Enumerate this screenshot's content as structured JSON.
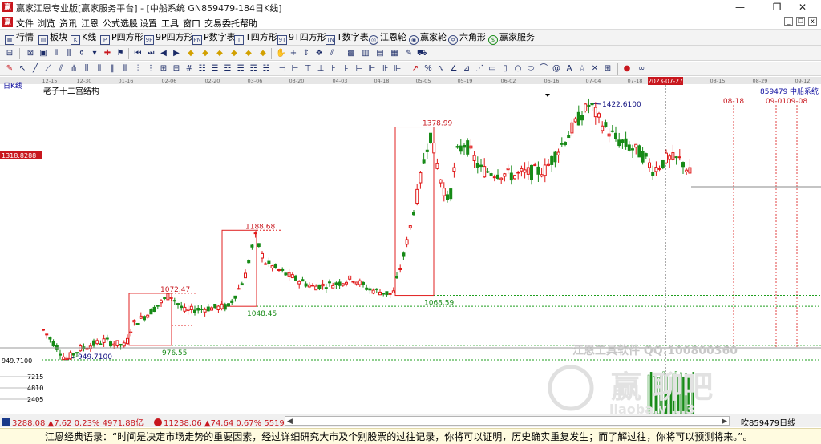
{
  "window": {
    "title": "赢家江恩专业版[赢家服务平台] - [中船系统  GN859479-184日K线]",
    "logo_text": "赢"
  },
  "menu": [
    "文件",
    "浏览",
    "资讯",
    "江恩",
    "公式选股",
    "设置",
    "工具",
    "窗口",
    "交易委托",
    "帮助"
  ],
  "toolbar1": [
    {
      "label": "行情",
      "icon": "grid-icon"
    },
    {
      "label": "板块",
      "icon": "blocks-icon"
    },
    {
      "label": "K线",
      "icon": "kline-icon"
    },
    {
      "label": "P四方形",
      "icon": "p-square-icon"
    },
    {
      "label": "9P四方形",
      "icon": "9p-square-icon"
    },
    {
      "label": "P数字表",
      "icon": "p-number-icon"
    },
    {
      "label": "T四方形",
      "icon": "t-square-icon"
    },
    {
      "label": "9T四方形",
      "icon": "9t-square-icon"
    },
    {
      "label": "T数字表",
      "icon": "t-number-icon"
    },
    {
      "label": "江恩轮",
      "icon": "gann-wheel-icon"
    },
    {
      "label": "赢家轮",
      "icon": "winner-wheel-icon"
    },
    {
      "label": "六角形",
      "icon": "hexagon-icon"
    },
    {
      "label": "赢家服务",
      "icon": "service-icon"
    }
  ],
  "chart": {
    "period_label": "日K线",
    "structure_name": "老子十二宫结构",
    "current_price": "1318.8288",
    "axis_low_label": "949.7100",
    "security_code": "859479",
    "security_name": "中船系统",
    "highlight_date": "2023-07-27",
    "date_ticks": [
      "12-15",
      "12-30",
      "01-16",
      "02-06",
      "02-20",
      "03-06",
      "03-20",
      "04-03",
      "04-18",
      "05-05",
      "05-19",
      "06-02",
      "06-16",
      "07-04",
      "07-18",
      "08-15",
      "08-29",
      "09-12"
    ],
    "future_dates": [
      "08-18",
      "09-01",
      "09-08"
    ],
    "price_labels": [
      "949.7100",
      "1072.47",
      "976.55",
      "1188.68",
      "1048.45",
      "1378.99",
      "1068.59",
      "1422.6100"
    ],
    "volume_ticks": [
      "7215",
      "4810",
      "2405"
    ],
    "watermark_tool": "江恩工具软件 QQ:100800360",
    "watermark_brand": "赢 聊吧",
    "watermark_url": "jiaoba.yi...3"
  },
  "chart_data": {
    "type": "candlestick",
    "title": "老子十二宫结构",
    "series_code": "859479",
    "series_name": "中船系统",
    "period": "日K线",
    "date_ticks": [
      "12-15",
      "12-30",
      "01-16",
      "02-06",
      "02-20",
      "03-06",
      "03-20",
      "04-03",
      "04-18",
      "05-05",
      "05-19",
      "06-02",
      "06-16",
      "07-04",
      "07-18"
    ],
    "marked_points": [
      {
        "label": "low",
        "value": 949.71
      },
      {
        "label": "box1_high",
        "value": 1072.47
      },
      {
        "label": "box1_low",
        "value": 976.55
      },
      {
        "label": "box2_high",
        "value": 1188.68
      },
      {
        "label": "box2_low",
        "value": 1048.45
      },
      {
        "label": "box3_high",
        "value": 1378.99
      },
      {
        "label": "box3_low",
        "value": 1068.59
      },
      {
        "label": "high",
        "value": 1422.61
      }
    ],
    "current_value": 1318.8288,
    "volume_axis": [
      7215,
      4810,
      2405
    ]
  },
  "status": {
    "index1": "3288.08 ▲7.62 0.23% 4971.88亿",
    "index2": "11238.06 ▲74.64 0.67% 5519.72亿",
    "code_label": "吹859479日线"
  },
  "quote": "江恩经典语录：“时间是决定市场走势的重要因素，经过详细研究大市及个别股票的过往记录，你将可以证明，历史确实重复发生；而了解过往，你将可以预测将来。”。",
  "colors": {
    "up": "#e01818",
    "down": "#178a17",
    "box": "#e02020",
    "dotted_green": "#1e9e1e",
    "highlight": "#c8171e",
    "label_blue": "#101080"
  }
}
